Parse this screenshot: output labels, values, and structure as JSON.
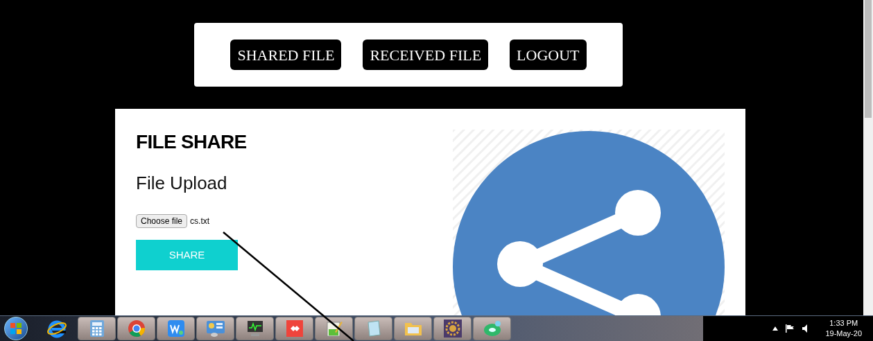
{
  "nav": {
    "buttons": [
      "SHARED FILE",
      "RECEIVED FILE",
      "LOGOUT"
    ]
  },
  "card": {
    "title": "FILE SHARE",
    "subtitle": "File Upload",
    "file_input": {
      "button": "Choose file",
      "value": "cs.txt"
    },
    "submit": "SHARE"
  },
  "taskbar": {
    "apps": [
      {
        "kind": "calculator"
      },
      {
        "kind": "chrome"
      },
      {
        "kind": "wps"
      },
      {
        "kind": "control"
      },
      {
        "kind": "monitor"
      },
      {
        "kind": "anydesk"
      },
      {
        "kind": "editor"
      },
      {
        "kind": "notepad"
      },
      {
        "kind": "folder"
      },
      {
        "kind": "javaee"
      },
      {
        "kind": "disc"
      }
    ],
    "clock": {
      "time": "1:33 PM",
      "date": "19-May-20"
    }
  }
}
